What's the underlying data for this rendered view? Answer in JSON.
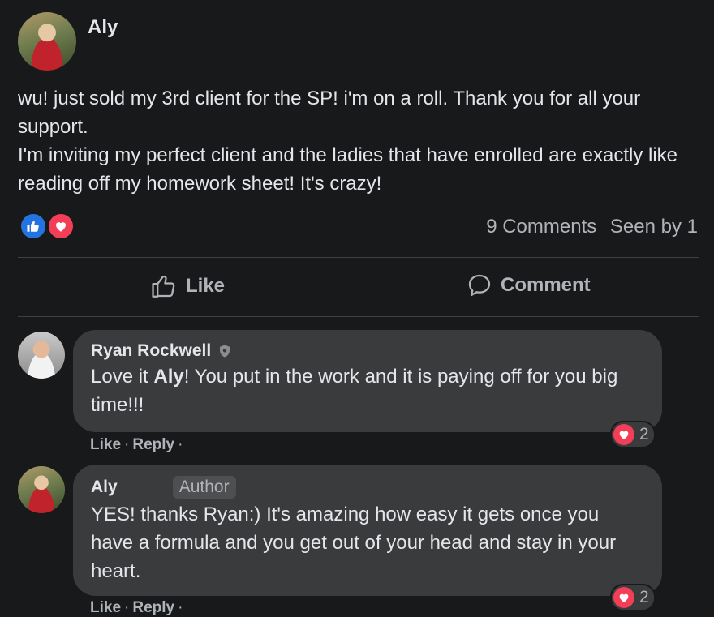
{
  "post": {
    "author": "Aly",
    "lines": [
      "wu! just sold my 3rd client for the SP!  i'm on a roll. Thank you for all your support.",
      "I'm inviting my perfect client and the ladies that have enrolled are exactly like reading off my homework sheet! It's crazy!"
    ],
    "comments_count": "9 Comments",
    "seen_by": "Seen by 1"
  },
  "actions": {
    "like": "Like",
    "comment": "Comment"
  },
  "comments": [
    {
      "author": "Ryan Rockwell",
      "text_before": "Love it ",
      "text_bold": "Aly",
      "text_after": "! You put in the work and it is paying off for you big time!!!",
      "reaction_count": "2",
      "like": "Like",
      "reply": "Reply"
    },
    {
      "author": "Aly",
      "badge": "Author",
      "text": "YES! thanks Ryan:) It's amazing how easy it gets once you have a formula and you get out of your head and stay in your heart.",
      "reaction_count": "2",
      "like": "Like",
      "reply": "Reply"
    }
  ],
  "colors": {
    "background": "#18191a",
    "bubble": "#3a3b3c",
    "like_blue": "#2374e1",
    "love_red": "#f33e58"
  },
  "icons": [
    "like-reaction-icon",
    "love-reaction-icon",
    "thumbs-up-icon",
    "comment-icon",
    "shield-icon"
  ]
}
